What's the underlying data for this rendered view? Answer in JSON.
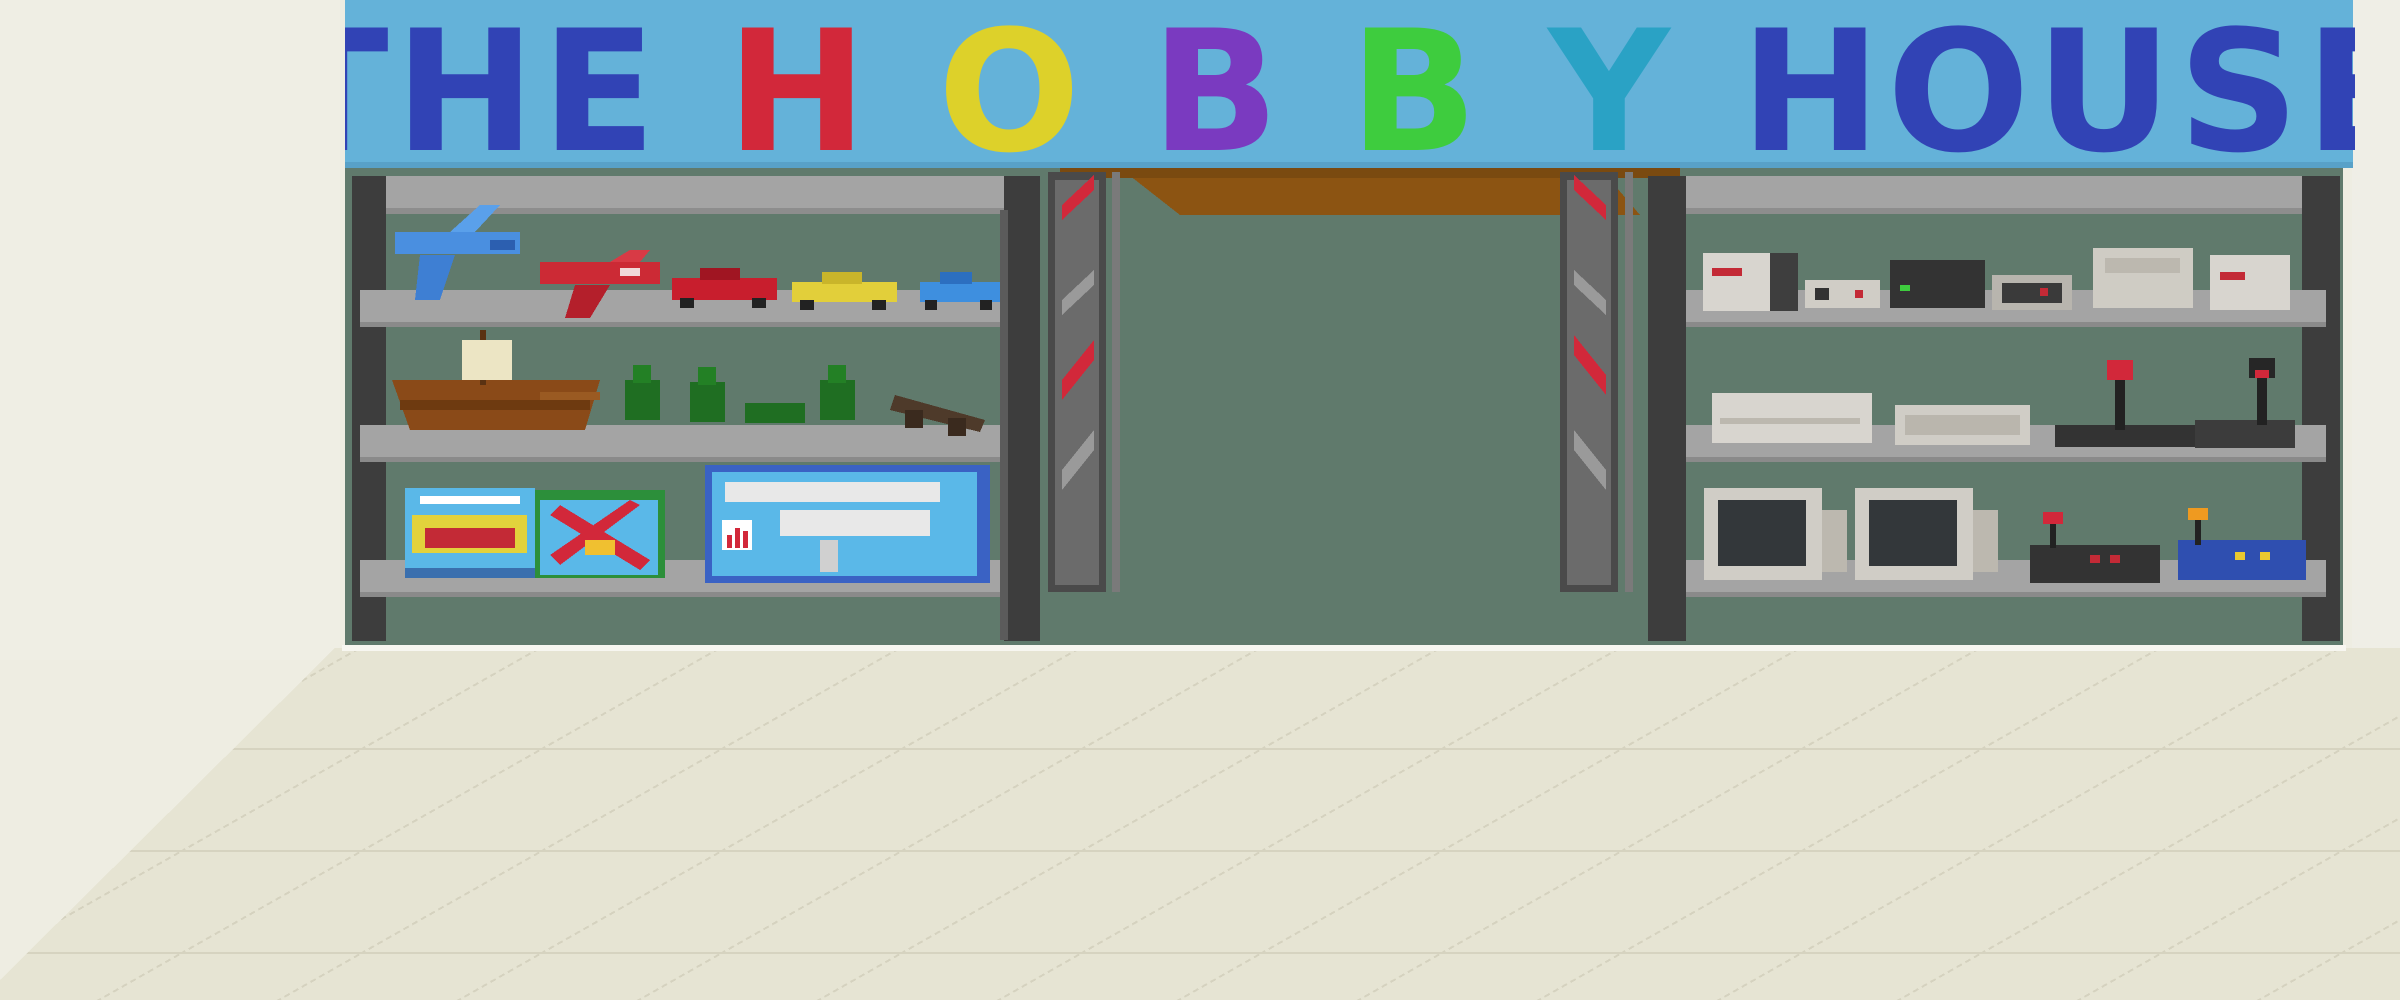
{
  "store": {
    "sign_words": [
      {
        "text": "THE",
        "color": "#3143b5"
      },
      {
        "text": "H",
        "color": "#d2283a"
      },
      {
        "text": "O",
        "color": "#ddd12a"
      },
      {
        "text": "B",
        "color": "#7a3ac0"
      },
      {
        "text": "B",
        "color": "#3ecc3e"
      },
      {
        "text": "Y",
        "color": "#2aa2c5"
      },
      {
        "text": "HOUSE",
        "color": "#3143b5"
      }
    ]
  },
  "palette": {
    "wall": "#eeede2",
    "floor": "#e6e4d3",
    "sign_bg": "#64b2d9",
    "interior": "#607a6c",
    "shelf": "#a4a4a4",
    "ceiling_wood": "#8c5412"
  },
  "items": {
    "left_shelves": [
      "blue-airplane-toy",
      "red-airplane-toy",
      "red-race-car",
      "yellow-race-car",
      "blue-race-car",
      "wooden-sailing-ship",
      "green-toy-soldiers",
      "toy-cannon",
      "boxed-car-kit",
      "boxed-biplane-kit",
      "boxed-airplane-model"
    ],
    "right_shelves": [
      "retro-game-consoles",
      "gamepads",
      "home-computers",
      "joysticks",
      "crt-monitors",
      "arcade-sticks"
    ]
  }
}
